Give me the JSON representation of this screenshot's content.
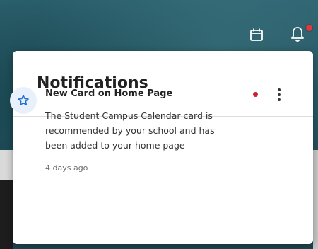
{
  "header": {
    "icons": [
      "calendar-icon",
      "bell-icon"
    ],
    "bell_has_badge": true
  },
  "notifications": {
    "title": "Notifications",
    "items": [
      {
        "icon": "star-icon",
        "title": "New Card on Home Page",
        "body_lines": [
          "The Student Campus Calendar card is",
          "recommended by your school and has",
          "been added to your home page"
        ],
        "time": "4 days ago",
        "unread": true
      }
    ]
  },
  "colors": {
    "badge": "#e2383b",
    "unread_dot": "#d0202b",
    "star": "#1f6fd1",
    "star_bg": "#e8f0fb"
  }
}
